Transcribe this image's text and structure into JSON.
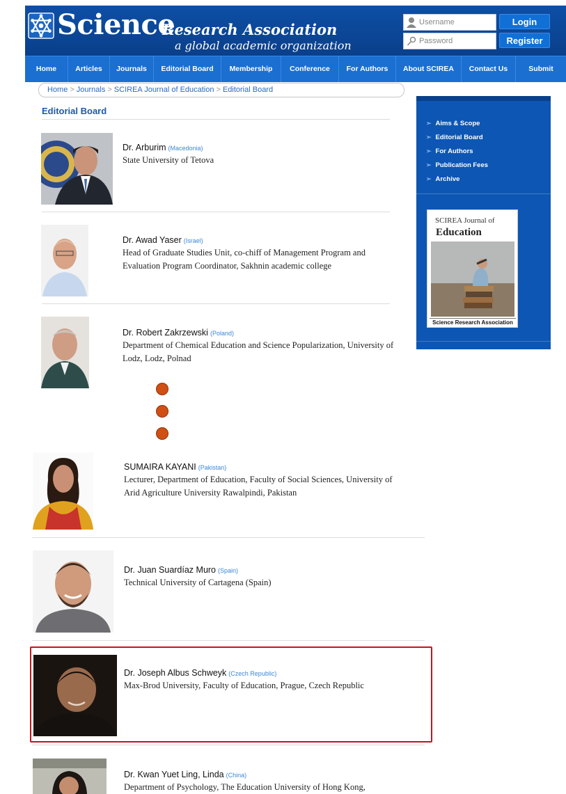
{
  "header": {
    "logo_title": "Science",
    "logo_subtitle": "Research Association",
    "logo_tagline": "a global academic organization",
    "username_placeholder": "Username",
    "password_placeholder": "Password",
    "login_label": "Login",
    "register_label": "Register"
  },
  "nav": {
    "items": [
      "Home",
      "Articles",
      "Journals",
      "Editorial Board",
      "Membership",
      "Conference",
      "For Authors",
      "About SCIREA",
      "Contact Us",
      "Submit"
    ]
  },
  "breadcrumb": {
    "items": [
      "Home",
      "Journals",
      "SCIREA Journal of Education",
      "Editorial Board"
    ],
    "separator": ">"
  },
  "page_title": "Editorial Board",
  "members": [
    {
      "name": "Dr. Arburim",
      "country": "(Macedonia)",
      "affiliation": "State University of Tetova"
    },
    {
      "name": "Dr. Awad Yaser",
      "country": "(Israel)",
      "affiliation": "Head of Graduate Studies Unit, co-chiff of Management Program and Evaluation Program Coordinator, Sakhnin academic college"
    },
    {
      "name": "Dr. Robert Zakrzewski",
      "country": "(Poland)",
      "affiliation": "Department of Chemical Education and Science Popularization, University of Lodz, Lodz, Polnad"
    },
    {
      "name": "SUMAIRA KAYANI",
      "country": "(Pakistan)",
      "affiliation": "Lecturer, Department of Education, Faculty of Social Sciences, University of Arid Agriculture University Rawalpindi, Pakistan"
    },
    {
      "name": "Dr. Juan Suardíaz Muro",
      "country": "(Spain)",
      "affiliation": "Technical University of Cartagena (Spain)"
    },
    {
      "name": "Dr. Joseph Albus Schweyk",
      "country": "(Czech Republic)",
      "affiliation": "Max-Brod University, Faculty of Education, Prague, Czech Republic"
    },
    {
      "name": "Dr. Kwan Yuet Ling, Linda",
      "country": "(China)",
      "affiliation": "Department of Psychology, The Education University of Hong Kong,"
    }
  ],
  "sidebar": {
    "links": [
      "Aims & Scope",
      "Editorial Board",
      "For Authors",
      "Publication Fees",
      "Archive"
    ],
    "journal_small": "SCIREA Journal of",
    "journal_big": "Education",
    "journal_publisher": "Science Research Association"
  },
  "colors": {
    "header_blue": "#0d4fa6",
    "nav_blue": "#1a6fd1",
    "sidebar_blue": "#0d56b3",
    "link_blue": "#2a69c4",
    "dot_orange": "#cf4f14",
    "highlight_red": "#c0161c"
  },
  "icons": [
    "logo-star-icon",
    "user-icon",
    "key-icon",
    "arrow-bullet-icon"
  ]
}
